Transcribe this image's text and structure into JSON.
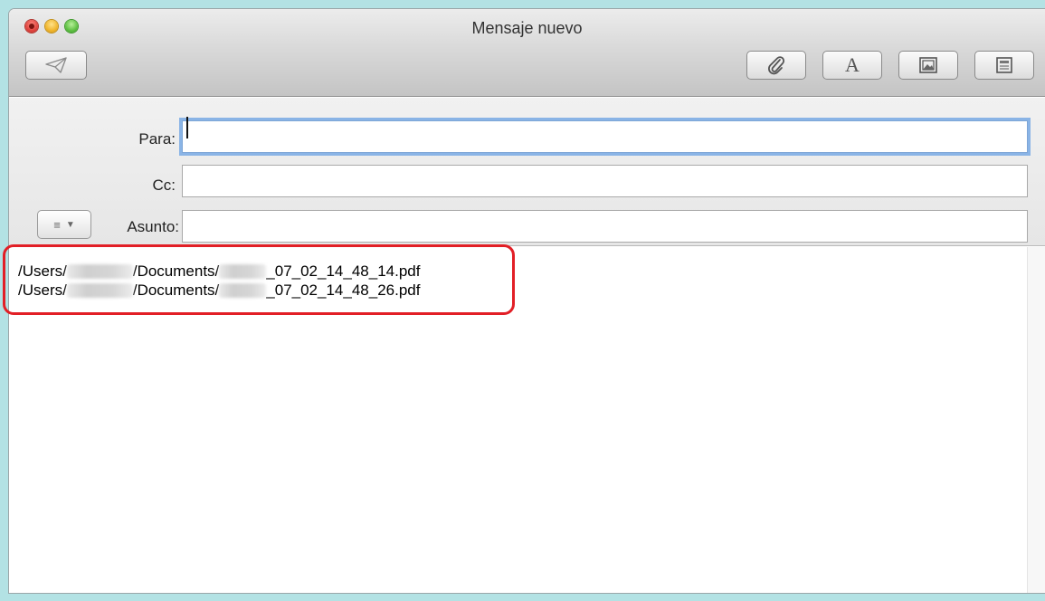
{
  "window": {
    "title": "Mensaje nuevo",
    "traffic_lights": [
      "close",
      "minimize",
      "zoom"
    ]
  },
  "toolbar": {
    "send_icon": "paper-plane-icon",
    "attach_icon": "paperclip-icon",
    "fonts_label": "A",
    "photo_icon": "photo-browser-icon",
    "template_icon": "stationery-icon"
  },
  "header": {
    "to_label": "Para:",
    "to_value": "",
    "cc_label": "Cc:",
    "cc_value": "",
    "subject_label": "Asunto:",
    "subject_value": "",
    "fields_menu_icon": "list-icon"
  },
  "body": {
    "lines": [
      {
        "prefix": "/Users/",
        "middle": "/Documents/",
        "suffix": "_07_02_14_48_14.pdf"
      },
      {
        "prefix": "/Users/",
        "middle": "/Documents/",
        "suffix": "_07_02_14_48_26.pdf"
      }
    ]
  },
  "colors": {
    "background": "#b3e2e4",
    "highlight_border": "#e21f26",
    "focus_ring": "#8ab4e6"
  }
}
